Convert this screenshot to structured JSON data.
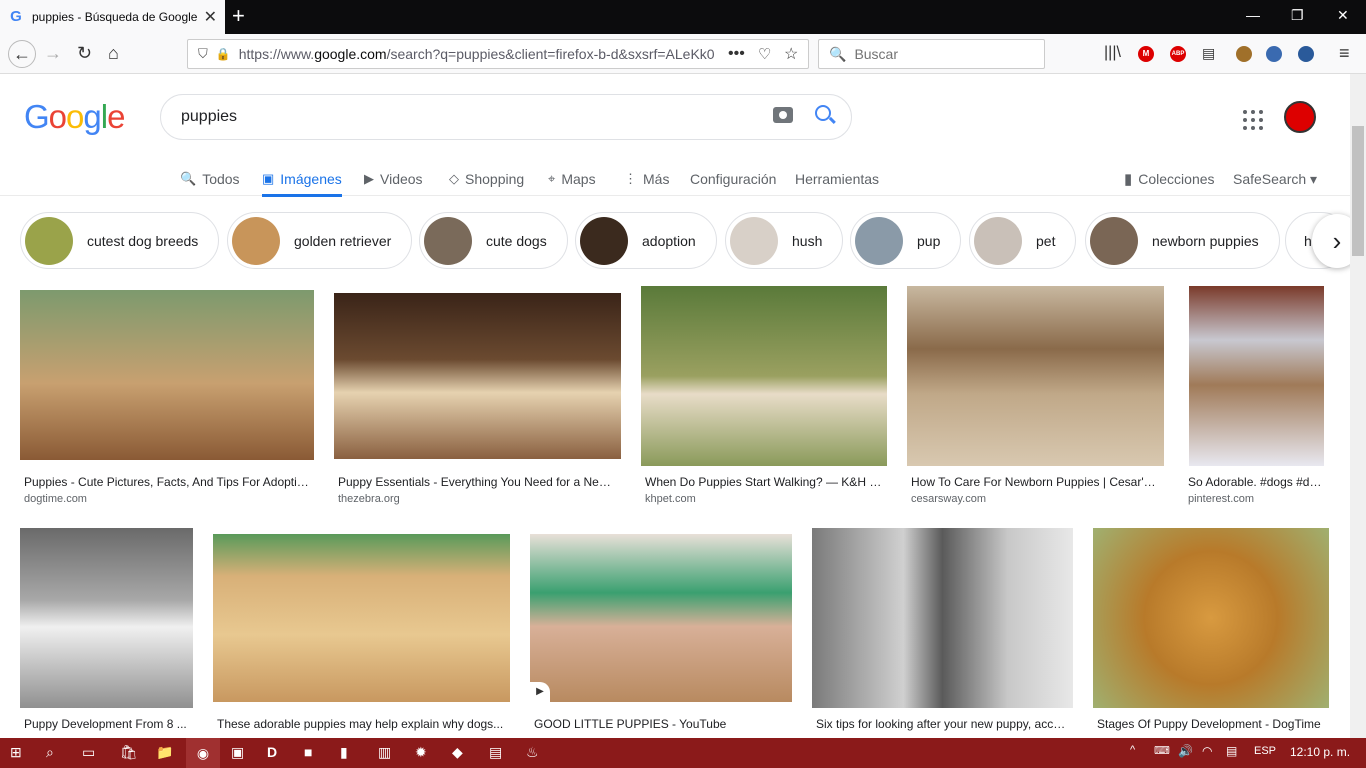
{
  "browser": {
    "tab_title": "puppies - Búsqueda de Google",
    "tab_favicon": "G",
    "url_prefix": "https://www.",
    "url_domain": "google.com",
    "url_rest": "/search?q=puppies&client=firefox-b-d&sxsrf=ALeKk0",
    "search_placeholder": "Buscar",
    "ext_badges": [
      "M",
      "ABP"
    ]
  },
  "google": {
    "logo": "Google",
    "query": "puppies",
    "tabs": [
      {
        "label": "Todos",
        "icon": "🔍"
      },
      {
        "label": "Imágenes",
        "icon": "▣"
      },
      {
        "label": "Videos",
        "icon": "▶"
      },
      {
        "label": "Shopping",
        "icon": "◇"
      },
      {
        "label": "Maps",
        "icon": "⌖"
      },
      {
        "label": "Más",
        "icon": "⋮"
      },
      {
        "label": "Configuración",
        "icon": ""
      },
      {
        "label": "Herramientas",
        "icon": ""
      }
    ],
    "collections": "Colecciones",
    "safesearch": "SafeSearch ▾"
  },
  "chips": [
    {
      "label": "cutest dog breeds",
      "color": "#9aa34a"
    },
    {
      "label": "golden retriever",
      "color": "#c8955a"
    },
    {
      "label": "cute dogs",
      "color": "#7a6a5a"
    },
    {
      "label": "adoption",
      "color": "#3b2a1e"
    },
    {
      "label": "hush",
      "color": "#d8d0c8"
    },
    {
      "label": "pup",
      "color": "#8a9aa8"
    },
    {
      "label": "pet",
      "color": "#c9c0b8"
    },
    {
      "label": "newborn puppies",
      "color": "#7a6655"
    },
    {
      "label": "hush puppies",
      "color": "#d8d0c8"
    }
  ],
  "results": [
    {
      "caption": "Puppies - Cute Pictures, Facts, And Tips For Adoptin...",
      "domain": "dogtime.com",
      "color": "#b98a55"
    },
    {
      "caption": "Puppy Essentials - Everything You Need for a New ...",
      "domain": "thezebra.org",
      "color": "#6b4a30"
    },
    {
      "caption": "When Do Puppies Start Walking? — K&H Pet ...",
      "domain": "khpet.com",
      "color": "#7a8a4a"
    },
    {
      "caption": "How To Care For Newborn Puppies | Cesar's Way",
      "domain": "cesarsway.com",
      "color": "#b09a80"
    },
    {
      "caption": "So Adorable. #dogs #dog...",
      "domain": "pinterest.com",
      "color": "#8a6a50"
    },
    {
      "caption": "Puppy Development From 8 ...",
      "domain": "",
      "color": "#9aa0a8"
    },
    {
      "caption": "These adorable puppies may help explain why dogs...",
      "domain": "",
      "color": "#d4b070"
    },
    {
      "caption": "GOOD LITTLE PUPPIES - YouTube",
      "domain": "",
      "color": "#c8a88a"
    },
    {
      "caption": "Six tips for looking after your new puppy, according...",
      "domain": "",
      "color": "#8a8a8a"
    },
    {
      "caption": "Stages Of Puppy Development - DogTime",
      "domain": "",
      "color": "#d49a40"
    }
  ],
  "taskbar": {
    "lang": "ESP",
    "time": "12:10 p. m."
  }
}
